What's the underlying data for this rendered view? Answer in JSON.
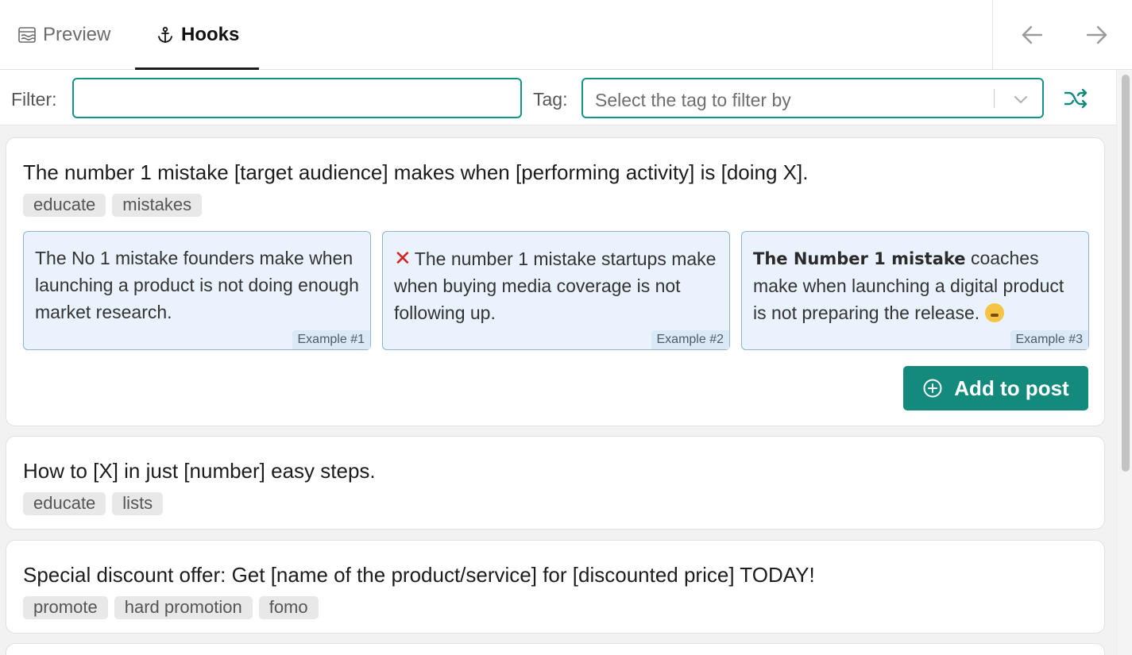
{
  "tabs": {
    "preview_label": "Preview",
    "hooks_label": "Hooks",
    "active": "Hooks"
  },
  "filter": {
    "filter_label": "Filter:",
    "filter_value": "",
    "tag_label": "Tag:",
    "tag_placeholder": "Select the tag to filter by"
  },
  "colors": {
    "accent": "#148a7d",
    "example_bg": "#eaf3fd"
  },
  "hooks": [
    {
      "title": "The number 1 mistake [target audience] makes when [performing activity] is [doing X].",
      "tags": [
        "educate",
        "mistakes"
      ],
      "examples": [
        {
          "text": "The No 1 mistake founders make when launching a product is not doing enough market research.",
          "badge": "Example #1"
        },
        {
          "icon": "cross-mark-icon",
          "text": "The number 1 mistake startups make when buying media coverage is not following up.",
          "badge": "Example #2"
        },
        {
          "bold": "The Number 1 mistake",
          "text": "coaches make when launching a digital product is not preparing the release.",
          "emoji": "exploding-head-emoji",
          "badge": "Example #3"
        }
      ],
      "add_label": "Add to post"
    },
    {
      "title": "How to [X] in just [number] easy steps.",
      "tags": [
        "educate",
        "lists"
      ]
    },
    {
      "title": "Special discount offer: Get [name of the product/service] for [discounted price] TODAY!",
      "tags": [
        "promote",
        "hard promotion",
        "fomo"
      ]
    }
  ]
}
